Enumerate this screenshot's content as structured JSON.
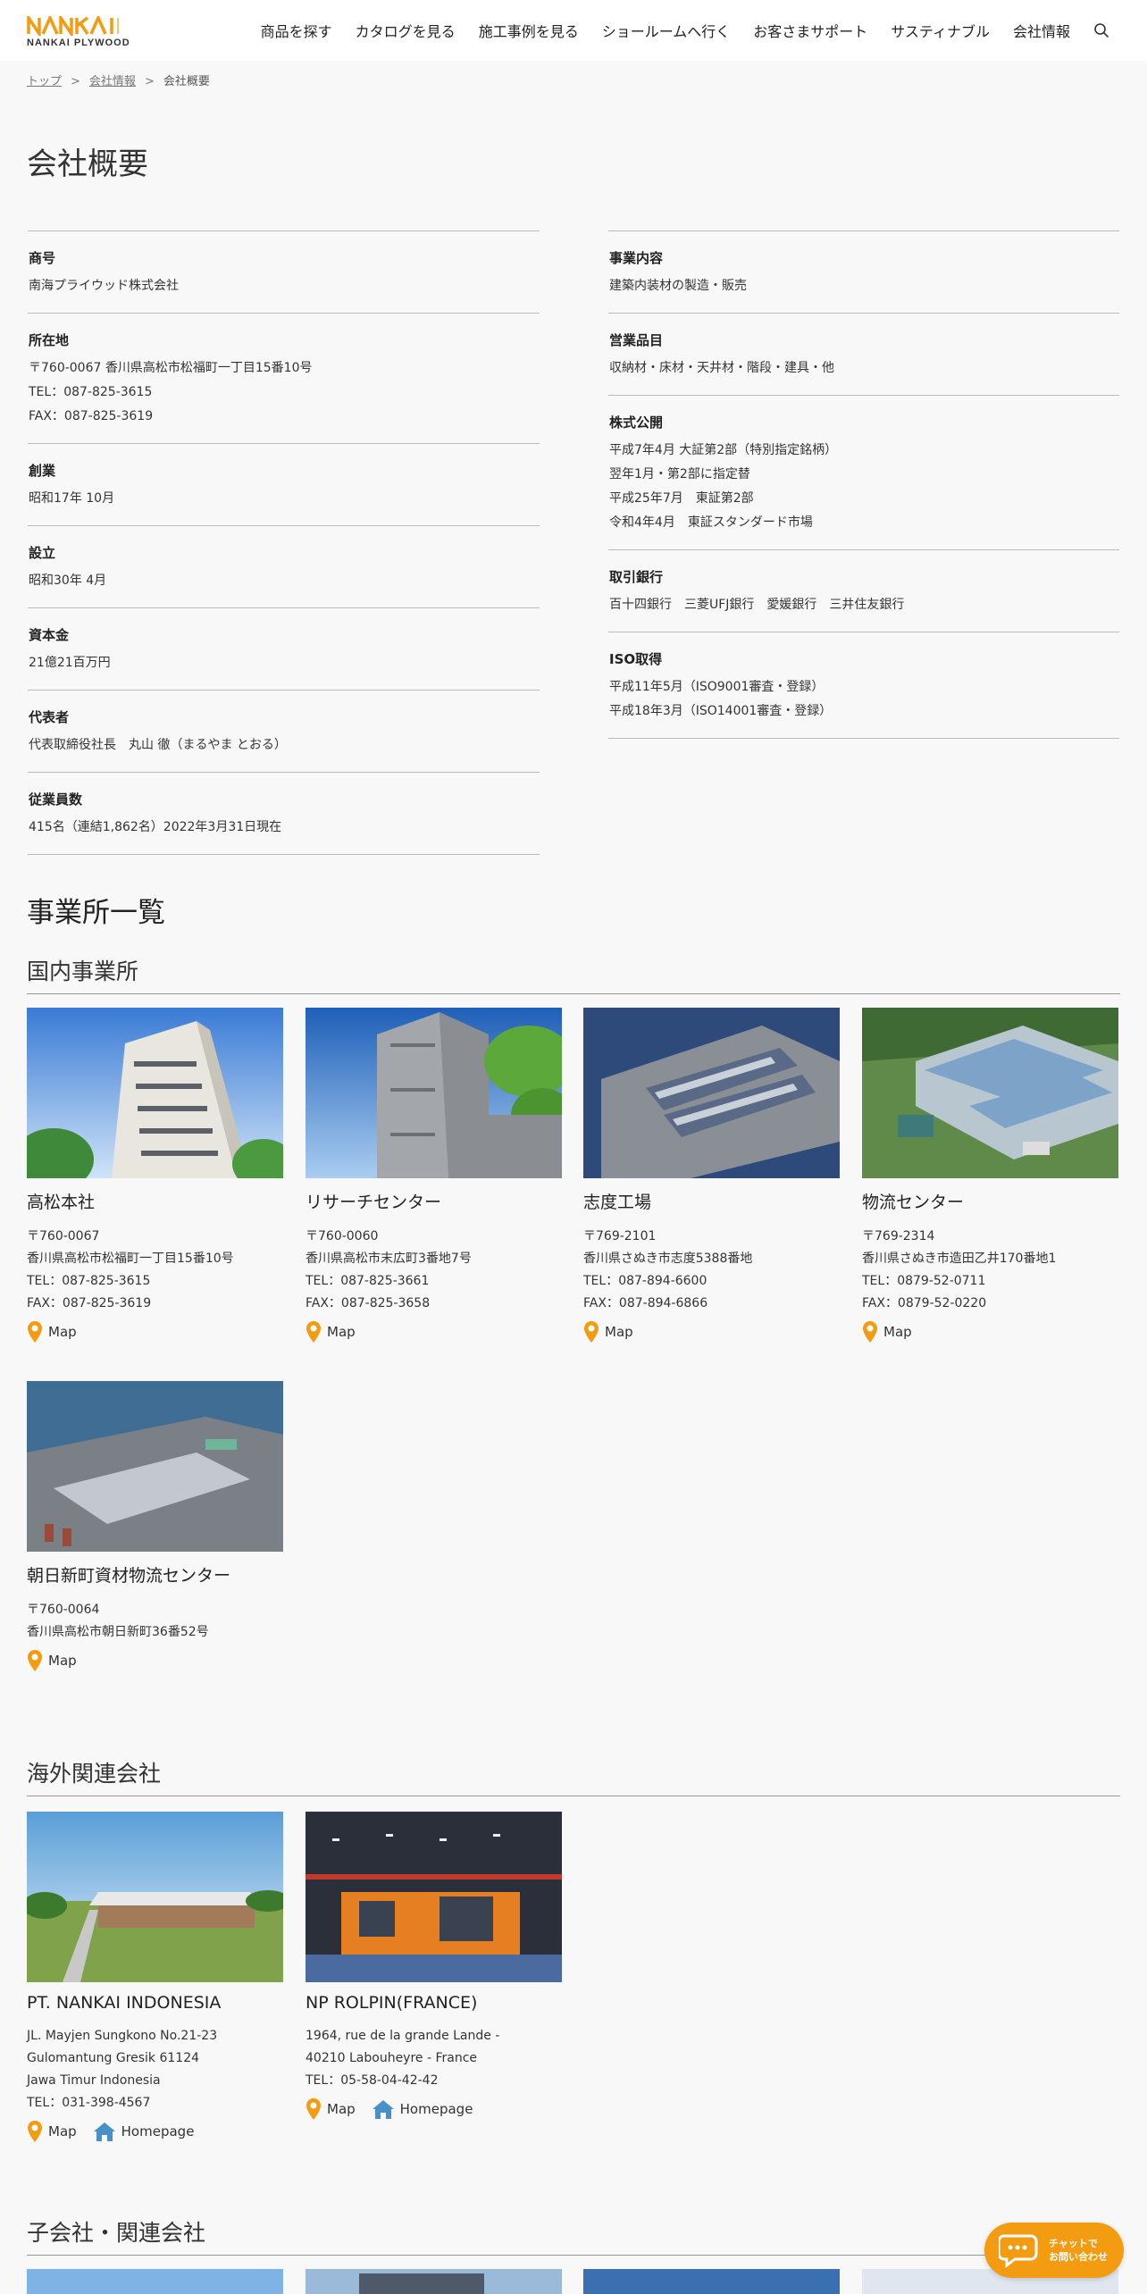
{
  "header": {
    "logo_text": "NANKAI PLYWOOD",
    "nav": [
      "商品を探す",
      "カタログを見る",
      "施工事例を見る",
      "ショールームへ行く",
      "お客さまサポート",
      "サスティナブル",
      "会社情報"
    ]
  },
  "breadcrumb": {
    "top": "トップ",
    "company": "会社情報",
    "current": "会社概要",
    "separator": ">"
  },
  "page_title": "会社概要",
  "info_left": [
    {
      "label": "商号",
      "lines": [
        "南海プライウッド株式会社"
      ]
    },
    {
      "label": "所在地",
      "lines": [
        "〒760-0067 香川県高松市松福町一丁目15番10号",
        "TEL：087-825-3615",
        "FAX：087-825-3619"
      ]
    },
    {
      "label": "創業",
      "lines": [
        "昭和17年 10月"
      ]
    },
    {
      "label": "設立",
      "lines": [
        "昭和30年 4月"
      ]
    },
    {
      "label": "資本金",
      "lines": [
        "21億21百万円"
      ]
    },
    {
      "label": "代表者",
      "lines": [
        "代表取締役社長　丸山 徹（まるやま とおる）"
      ]
    },
    {
      "label": "従業員数",
      "lines": [
        "415名（連結1,862名）2022年3月31日現在"
      ]
    }
  ],
  "info_right": [
    {
      "label": "事業内容",
      "lines": [
        "建築内装材の製造・販売"
      ]
    },
    {
      "label": "営業品目",
      "lines": [
        "収納材・床材・天井材・階段・建具・他"
      ]
    },
    {
      "label": "株式公開",
      "lines": [
        "平成7年4月 大証第2部（特別指定銘柄）",
        "翌年1月・第2部に指定替",
        "平成25年7月　東証第2部",
        "令和4年4月　東証スタンダード市場"
      ]
    },
    {
      "label": "取引銀行",
      "lines": [
        "百十四銀行　三菱UFJ銀行　愛媛銀行　三井住友銀行"
      ]
    },
    {
      "label": "ISO取得",
      "lines": [
        "平成11年5月（ISO9001審査・登録）",
        "平成18年3月（ISO14001審査・登録）"
      ]
    }
  ],
  "offices_title": "事業所一覧",
  "domestic_title": "国内事業所",
  "map_label": "Map",
  "homepage_label": "Homepage",
  "domestic": [
    {
      "name": "高松本社",
      "lines": [
        "〒760-0067",
        "香川県高松市松福町一丁目15番10号",
        "TEL：087-825-3615",
        "FAX：087-825-3619"
      ]
    },
    {
      "name": "リサーチセンター",
      "lines": [
        "〒760-0060",
        "香川県高松市末広町3番地7号",
        "TEL：087-825-3661",
        "FAX：087-825-3658"
      ]
    },
    {
      "name": "志度工場",
      "lines": [
        "〒769-2101",
        "香川県さぬき市志度5388番地",
        "TEL：087-894-6600",
        "FAX：087-894-6866"
      ]
    },
    {
      "name": "物流センター",
      "lines": [
        "〒769-2314",
        "香川県さぬき市造田乙井170番地1",
        "TEL：0879-52-0711",
        "FAX：0879-52-0220"
      ]
    },
    {
      "name": "朝日新町資材物流センター",
      "lines": [
        "〒760-0064",
        "香川県高松市朝日新町36番52号"
      ]
    }
  ],
  "overseas_title": "海外関連会社",
  "overseas": [
    {
      "name": "PT. NANKAI INDONESIA",
      "lines": [
        "JL. Mayjen Sungkono No.21-23",
        "Gulomantung Gresik 61124",
        "Jawa Timur Indonesia",
        "TEL：031-398-4567"
      ]
    },
    {
      "name": "NP ROLPIN(FRANCE)",
      "lines": [
        "1964, rue de la grande Lande -",
        "40210 Labouheyre - France",
        "TEL：05-58-04-42-42"
      ]
    }
  ],
  "subsidiaries_title": "子会社・関連会社",
  "chat": {
    "line1": "チャットで",
    "line2": "お問い合わせ"
  },
  "colors": {
    "accent": "#f39c12",
    "home_icon": "#4a90c8"
  }
}
